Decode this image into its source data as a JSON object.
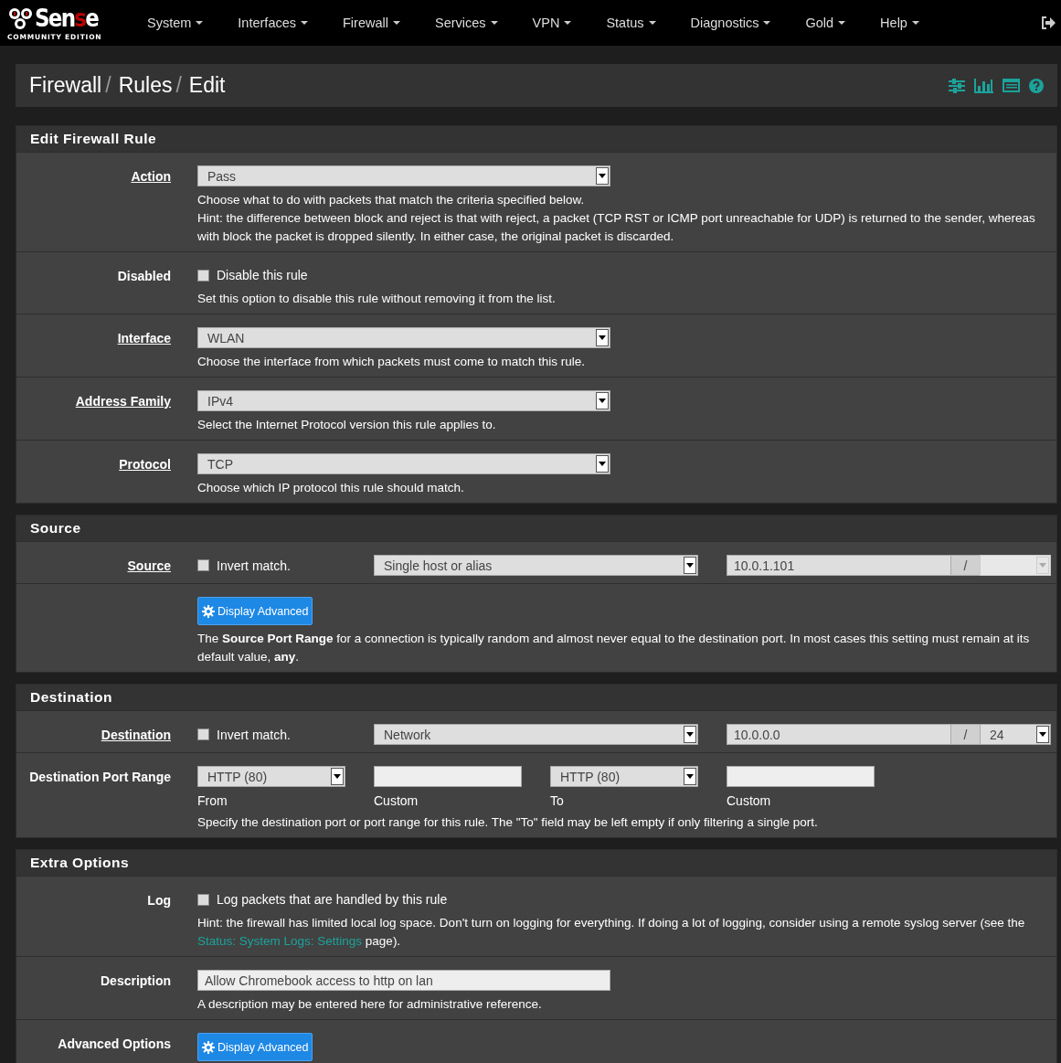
{
  "navbar": {
    "brand": {
      "parts": [
        {
          "text": "Sen",
          "accent": false
        },
        {
          "text": "s",
          "accent": true
        },
        {
          "text": "e",
          "accent": false
        }
      ],
      "subtitle": "COMMUNITY EDITION"
    },
    "menu": [
      "System",
      "Interfaces",
      "Firewall",
      "Services",
      "VPN",
      "Status",
      "Diagnostics",
      "Gold",
      "Help"
    ]
  },
  "breadcrumb": [
    {
      "kind": "crumb",
      "text": "Firewall"
    },
    {
      "kind": "sep",
      "text": "/"
    },
    {
      "kind": "crumb",
      "text": "Rules"
    },
    {
      "kind": "sep",
      "text": "/"
    },
    {
      "kind": "crumb",
      "text": "Edit"
    }
  ],
  "sections": [
    {
      "title": "Edit Firewall Rule",
      "rows": [
        {
          "kind": "select",
          "label": "Action",
          "link": true,
          "value": "Pass",
          "help": [
            [
              {
                "kind": "text",
                "text": "Choose what to do with packets that match the criteria specified below."
              }
            ],
            [
              {
                "kind": "text",
                "text": "Hint: the difference between block and reject is that with reject, a packet (TCP RST or ICMP port unreachable for UDP) is returned to the sender, whereas with block the packet is dropped silently. In either case, the original packet is discarded."
              }
            ]
          ]
        },
        {
          "kind": "checkbox",
          "label": "Disabled",
          "link": false,
          "checked": false,
          "text": "Disable this rule",
          "help": [
            [
              {
                "kind": "text",
                "text": "Set this option to disable this rule without removing it from the list."
              }
            ]
          ]
        },
        {
          "kind": "select",
          "label": "Interface",
          "link": true,
          "value": "WLAN",
          "help": [
            [
              {
                "kind": "text",
                "text": "Choose the interface from which packets must come to match this rule."
              }
            ]
          ]
        },
        {
          "kind": "select",
          "label": "Address Family",
          "link": true,
          "value": "IPv4",
          "help": [
            [
              {
                "kind": "text",
                "text": "Select the Internet Protocol version this rule applies to."
              }
            ]
          ]
        },
        {
          "kind": "select",
          "label": "Protocol",
          "link": true,
          "value": "TCP",
          "help": [
            [
              {
                "kind": "text",
                "text": "Choose which IP protocol this rule should match."
              }
            ]
          ]
        }
      ]
    },
    {
      "title": "Source",
      "rows": [
        {
          "kind": "address",
          "label": "Source",
          "link": true,
          "invert": {
            "text": "Invert match.",
            "checked": false
          },
          "type": "Single host or alias",
          "address": "10.0.1.101",
          "slash": "/",
          "mask": {
            "disabled": true
          }
        },
        {
          "kind": "button",
          "button": "Display Advanced",
          "help": [
            [
              {
                "kind": "text",
                "text": "The **Source Port Range** for a connection is typically random and almost never equal to the destination port. In most cases this setting must remain at its default value, **any**."
              }
            ]
          ]
        }
      ]
    },
    {
      "title": "Destination",
      "rows": [
        {
          "kind": "address",
          "label": "Destination",
          "link": true,
          "invert": {
            "text": "Invert match.",
            "checked": false
          },
          "type": "Network",
          "address": "10.0.0.0",
          "slash": "/",
          "mask": {
            "disabled": false,
            "value": "24"
          }
        },
        {
          "kind": "ports",
          "label": "Destination Port Range",
          "link": false,
          "fields": [
            {
              "kind": "select",
              "value": "HTTP (80)",
              "caption": "From"
            },
            {
              "kind": "input",
              "caption": "Custom"
            },
            {
              "kind": "select",
              "value": "HTTP (80)",
              "caption": "To"
            },
            {
              "kind": "input",
              "caption": "Custom"
            }
          ],
          "help": [
            [
              {
                "kind": "text",
                "text": "Specify the destination port or port range for this rule. The \"To\" field may be left empty if only filtering a single port."
              }
            ]
          ]
        }
      ]
    },
    {
      "title": "Extra Options",
      "rows": [
        {
          "kind": "checkbox",
          "label": "Log",
          "link": false,
          "checked": false,
          "text": "Log packets that are handled by this rule",
          "help": [
            [
              {
                "kind": "text",
                "text": "Hint: the firewall has limited local log space. Don't turn on logging for everything. If doing a lot of logging, consider using a remote syslog server (see the "
              },
              {
                "kind": "link",
                "text": "Status: System Logs: Settings"
              },
              {
                "kind": "text",
                "text": " page)."
              }
            ]
          ]
        },
        {
          "kind": "input",
          "label": "Description",
          "link": false,
          "value": "Allow Chromebook access to http on lan",
          "help": [
            [
              {
                "kind": "text",
                "text": "A description may be entered here for administrative reference."
              }
            ]
          ]
        },
        {
          "kind": "button",
          "label": "Advanced Options",
          "link": false,
          "button": "Display Advanced"
        }
      ]
    }
  ]
}
